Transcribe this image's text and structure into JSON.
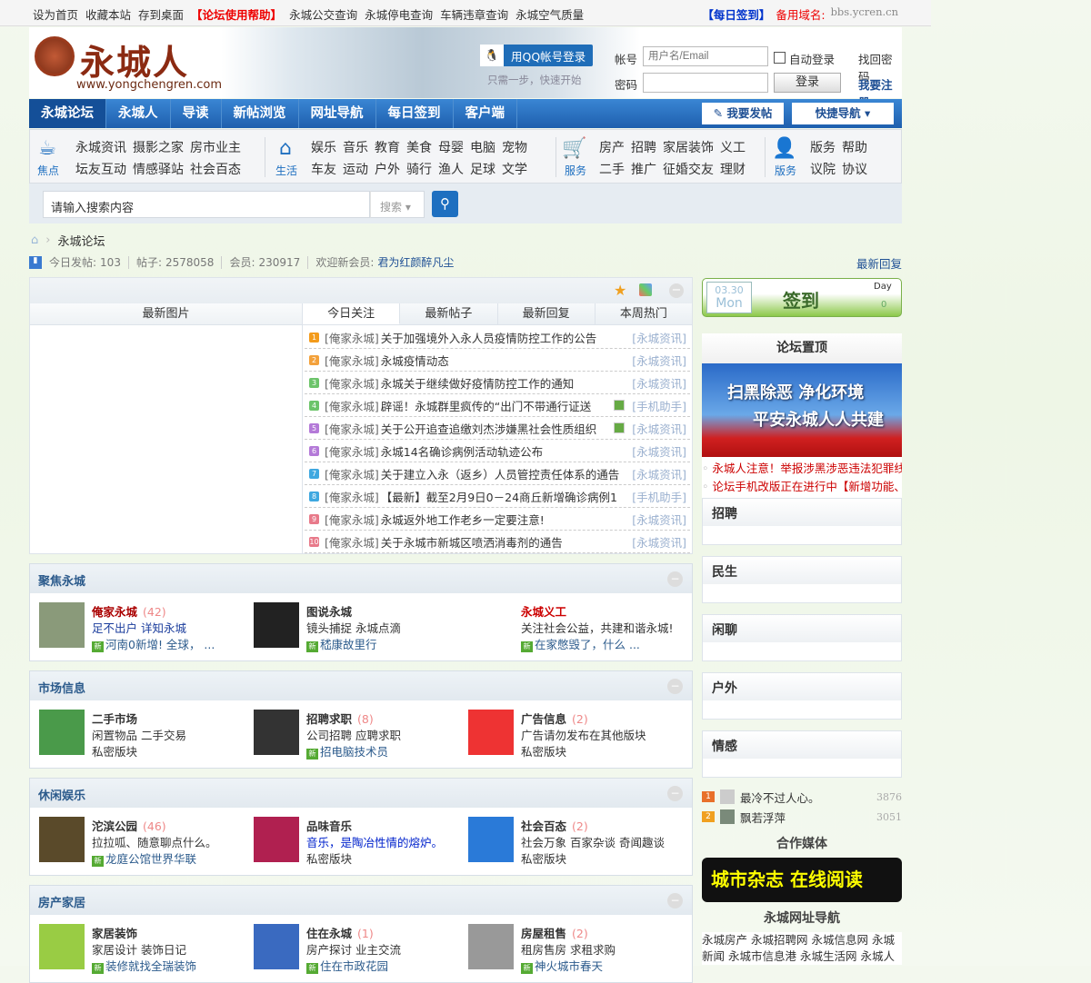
{
  "topbar": {
    "left": [
      "设为首页",
      "收藏本站",
      "存到桌面"
    ],
    "help": "【论坛使用帮助】",
    "links": [
      "永城公交查询",
      "永城停电查询",
      "车辆违章查询",
      "永城空气质量"
    ],
    "checkin": "【每日签到】",
    "domain_label": "备用域名:",
    "domain": "bbs.ycren.cn"
  },
  "header": {
    "logo_text": "永城人",
    "logo_url": "www.yongchengren.com",
    "qq_login": "用QQ帐号登录",
    "qq_tip": "只需一步，快速开始",
    "account_label": "帐号",
    "account_placeholder": "用户名/Email",
    "password_label": "密码",
    "auto_login": "自动登录",
    "find_password": "找回密码",
    "login": "登录",
    "register": "我要注册"
  },
  "nav": {
    "items": [
      "永城论坛",
      "永城人",
      "导读",
      "新帖浏览",
      "网址导航",
      "每日签到",
      "客户端"
    ],
    "post_button": "我要发帖",
    "quick_nav": "快捷导航"
  },
  "quick": [
    {
      "caption": "焦点",
      "links": [
        "永城资讯",
        "摄影之家",
        "房市业主",
        "坛友互动",
        "情感驿站",
        "社会百态"
      ]
    },
    {
      "caption": "生活",
      "links": [
        "娱乐",
        "音乐",
        "教育",
        "美食",
        "母婴",
        "电脑",
        "宠物",
        "车友",
        "运动",
        "户外",
        "骑行",
        "渔人",
        "足球",
        "文学"
      ]
    },
    {
      "caption": "服务",
      "links": [
        "房产",
        "招聘",
        "家居装饰",
        "义工",
        "二手",
        "推广",
        "征婚交友",
        "理财"
      ]
    },
    {
      "caption": "版务",
      "links": [
        "版务",
        "帮助",
        "议院",
        "协议"
      ]
    }
  ],
  "search": {
    "placeholder": "请输入搜索内容",
    "type": "搜索"
  },
  "breadcrumb": {
    "current": "永城论坛"
  },
  "stats": {
    "today_label": "今日发帖:",
    "today": "103",
    "posts_label": "帖子:",
    "posts": "2578058",
    "members_label": "会员:",
    "members": "230917",
    "welcome_label": "欢迎新会员:",
    "new_member": "君为红颜醉凡尘",
    "latest_reply": "最新回复"
  },
  "main": {
    "pics_title": "最新图片",
    "tabs": [
      "今日关注",
      "最新帖子",
      "最新回复",
      "本周热门"
    ],
    "posts": [
      {
        "n": "1",
        "color": "#f39b1b",
        "prefix": "[俺家永城]",
        "title": "关于加强境外入永人员疫情防控工作的公告",
        "cat": "[永城资讯]",
        "img": false
      },
      {
        "n": "2",
        "color": "#f3a13b",
        "prefix": "[俺家永城]",
        "title": "永城疫情动态",
        "cat": "[永城资讯]",
        "img": false
      },
      {
        "n": "3",
        "color": "#6cc46a",
        "prefix": "[俺家永城]",
        "title": "永城关于继续做好疫情防控工作的通知",
        "cat": "[永城资讯]",
        "img": false
      },
      {
        "n": "4",
        "color": "#6cc46a",
        "prefix": "[俺家永城]",
        "title": "辟谣！永城群里疯传的“出门不带通行证送",
        "cat": "[手机助手]",
        "img": true
      },
      {
        "n": "5",
        "color": "#b47ad8",
        "prefix": "[俺家永城]",
        "title": "关于公开追查追缴刘杰涉嫌黑社会性质组织",
        "cat": "[永城资讯]",
        "img": true
      },
      {
        "n": "6",
        "color": "#b47ad8",
        "prefix": "[俺家永城]",
        "title": "永城14名确诊病例活动轨迹公布",
        "cat": "[永城资讯]",
        "img": false
      },
      {
        "n": "7",
        "color": "#3fa8e0",
        "prefix": "[俺家永城]",
        "title": "关于建立入永（返乡）人员管控责任体系的通告",
        "cat": "[永城资讯]",
        "img": false
      },
      {
        "n": "8",
        "color": "#3fa8e0",
        "prefix": "[俺家永城]",
        "title": "【最新】截至2月9日0－24商丘新增确诊病例1",
        "cat": "[手机助手]",
        "img": false
      },
      {
        "n": "9",
        "color": "#e87a8a",
        "prefix": "[俺家永城]",
        "title": "永城返外地工作老乡一定要注意!",
        "cat": "[永城资讯]",
        "img": false
      },
      {
        "n": "10",
        "color": "#e87a8a",
        "prefix": "[俺家永城]",
        "title": "关于永城市新城区喷洒消毒剂的通告",
        "cat": "[永城资讯]",
        "img": false
      }
    ]
  },
  "sections": [
    {
      "title": "聚焦永城",
      "forums": [
        {
          "name": "俺家永城",
          "count": "(42)",
          "desc": "足不出户 详知永城",
          "latest": "河南0新增! 全球， ...",
          "thumb": "#8a9a7a",
          "name_color": "#a00",
          "desc_color": "#1a3c9c"
        },
        {
          "name": "图说永城",
          "count": "",
          "desc": "镜头捕捉 永城点滴",
          "latest": "嵇康故里行",
          "thumb": "#222",
          "name_color": "#333",
          "desc_color": "#333"
        },
        {
          "name": "永城义工",
          "count": "",
          "desc": "关注社会公益，共建和谐永城!",
          "latest": "在家憋毁了，什么 ...",
          "thumb": "#fff",
          "name_color": "#c00",
          "desc_color": "#333"
        }
      ]
    },
    {
      "title": "市场信息",
      "forums": [
        {
          "name": "二手市场",
          "count": "",
          "desc": "闲置物品 二手交易",
          "latest": "私密版块",
          "thumb": "#4a9a4a",
          "name_color": "#333",
          "desc_color": "#333",
          "private": true
        },
        {
          "name": "招聘求职",
          "count": "(8)",
          "desc": "公司招聘 应聘求职",
          "latest": "招电脑技术员",
          "thumb": "#333",
          "name_color": "#333",
          "desc_color": "#333"
        },
        {
          "name": "广告信息",
          "count": "(2)",
          "desc": "广告请勿发布在其他版块",
          "latest": "私密版块",
          "thumb": "#e33",
          "name_color": "#333",
          "desc_color": "#333",
          "private": true
        }
      ]
    },
    {
      "title": "休闲娱乐",
      "forums": [
        {
          "name": "沱滨公园",
          "count": "(46)",
          "desc": "拉拉呱、随意聊点什么。",
          "latest": "龙庭公馆世界华联",
          "thumb": "#5a4a2a",
          "name_color": "#333",
          "desc_color": "#333"
        },
        {
          "name": "品味音乐",
          "count": "",
          "desc": "音乐，是陶冶性情的熔炉。",
          "latest": "私密版块",
          "thumb": "#b02050",
          "name_color": "#333",
          "desc_color": "#0022cc",
          "private": true
        },
        {
          "name": "社会百态",
          "count": "(2)",
          "desc": "社会万象 百家杂谈 奇闻趣谈",
          "latest": "私密版块",
          "thumb": "#2a7ad8",
          "name_color": "#333",
          "desc_color": "#333",
          "private": true
        }
      ]
    },
    {
      "title": "房产家居",
      "forums": [
        {
          "name": "家居装饰",
          "count": "",
          "desc": "家居设计 装饰日记",
          "latest": "装修就找全瑞装饰",
          "thumb": "#9c4",
          "name_color": "#333",
          "desc_color": "#333"
        },
        {
          "name": "住在永城",
          "count": "(1)",
          "desc": "房产探讨 业主交流",
          "latest": "住在市政花园",
          "thumb": "#3a6ac0",
          "name_color": "#333",
          "desc_color": "#333"
        },
        {
          "name": "房屋租售",
          "count": "(2)",
          "desc": "租房售房 求租求购",
          "latest": "神火城市春天",
          "thumb": "#999",
          "name_color": "#333",
          "desc_color": "#333"
        }
      ]
    }
  ],
  "sidebar": {
    "signin": {
      "date": "03.30",
      "weekday": "Mon",
      "label": "签到",
      "day_label": "Day",
      "days": "0"
    },
    "sticky_title": "论坛置顶",
    "banner_lines": [
      "扫黑除恶 净化环境",
      "平安永城人人共建"
    ],
    "sticky_links": [
      "永城人注意！举报涉黑涉恶违法犯罪线",
      "论坛手机改版正在进行中【新增功能、"
    ],
    "boxes": [
      "招聘",
      "民生",
      "闲聊",
      "户外",
      "情感"
    ],
    "ranking": [
      {
        "rank": "1",
        "name": "最冷不过人心。",
        "score": "3876"
      },
      {
        "rank": "2",
        "name": "飘若浮萍",
        "score": "3051"
      }
    ],
    "media_title": "合作媒体",
    "media_banner": "城市杂志 在线阅读",
    "nav_title": "永城网址导航",
    "nav_links": [
      "永城房产",
      "永城招聘网",
      "永城信息网",
      "永城新闻",
      "永城市信息港",
      "永城生活网",
      "永城人"
    ]
  }
}
